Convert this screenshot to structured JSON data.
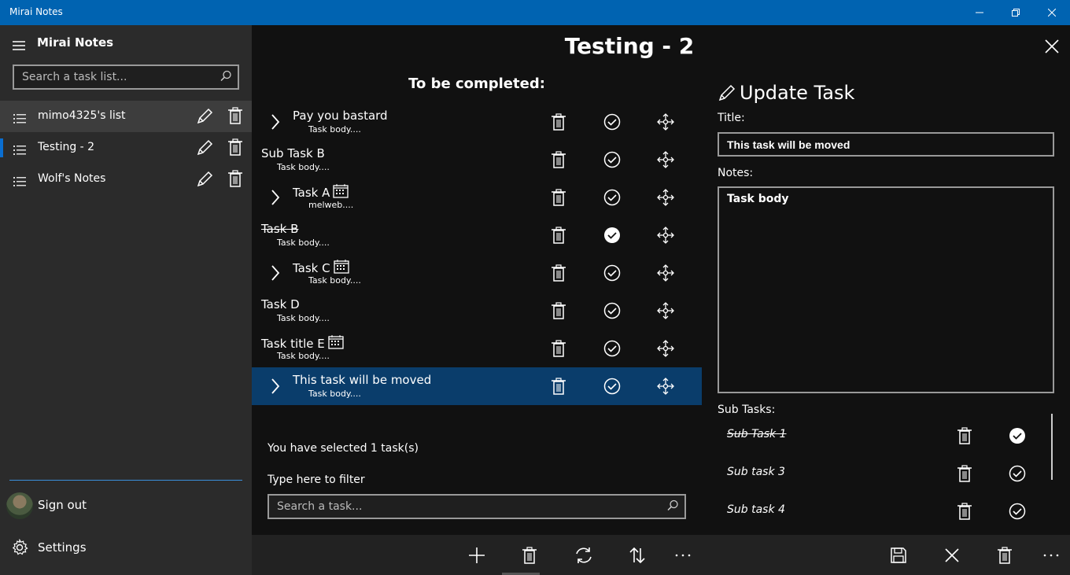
{
  "window": {
    "title": "Mirai Notes"
  },
  "sidebar": {
    "title": "Mirai Notes",
    "search_placeholder": "Search a task list...",
    "lists": [
      {
        "name": "mimo4325's list"
      },
      {
        "name": "Testing - 2"
      },
      {
        "name": "Wolf's Notes"
      }
    ],
    "sign_out": "Sign out",
    "settings": "Settings"
  },
  "main": {
    "title": "Testing - 2",
    "section_title": "To be completed:",
    "tasks": [
      {
        "title": "Pay you bastard",
        "body": "Task body....",
        "has_subtasks": true,
        "has_reminder": false,
        "completed": false,
        "indented": false
      },
      {
        "title": "Sub Task B",
        "body": "Task body....",
        "has_subtasks": false,
        "has_reminder": false,
        "completed": false,
        "indented": false
      },
      {
        "title": "Task A",
        "body": "melweb....",
        "has_subtasks": true,
        "has_reminder": true,
        "completed": false,
        "indented": false
      },
      {
        "title": "Task B",
        "body": "Task body....",
        "has_subtasks": false,
        "has_reminder": false,
        "completed": true,
        "indented": false
      },
      {
        "title": "Task C",
        "body": "Task body....",
        "has_subtasks": true,
        "has_reminder": true,
        "completed": false,
        "indented": false
      },
      {
        "title": "Task D",
        "body": "Task body....",
        "has_subtasks": false,
        "has_reminder": false,
        "completed": false,
        "indented": false
      },
      {
        "title": "Task title E",
        "body": "Task body....",
        "has_subtasks": false,
        "has_reminder": true,
        "completed": false,
        "indented": false
      },
      {
        "title": "This task will be moved",
        "body": "Task body....",
        "has_subtasks": true,
        "has_reminder": false,
        "completed": false,
        "selected": true
      }
    ],
    "selected_info": "You have selected 1 task(s)",
    "filter_label": "Type here to filter",
    "filter_placeholder": "Search a task..."
  },
  "edit_panel": {
    "title": "Update Task",
    "title_label": "Title:",
    "title_value": "This task will be moved",
    "notes_label": "Notes:",
    "notes_value": "Task body",
    "subtasks_label": "Sub Tasks:",
    "subtasks": [
      {
        "title": "Sub Task 1",
        "completed": true
      },
      {
        "title": "Sub task 3",
        "completed": false
      },
      {
        "title": "Sub task 4",
        "completed": false
      }
    ]
  },
  "bottom_bar": {
    "left_buttons": [
      "add-icon",
      "delete-icon",
      "sync-icon",
      "sort-icon",
      "more-icon"
    ],
    "right_buttons": [
      "save-icon",
      "close-icon",
      "delete-icon",
      "more-icon"
    ]
  },
  "colors": {
    "titlebar": "#0063b1",
    "selected_row": "#0a3d6b",
    "sidebar": "#2b2b2b",
    "accent": "#0a6ed1"
  }
}
